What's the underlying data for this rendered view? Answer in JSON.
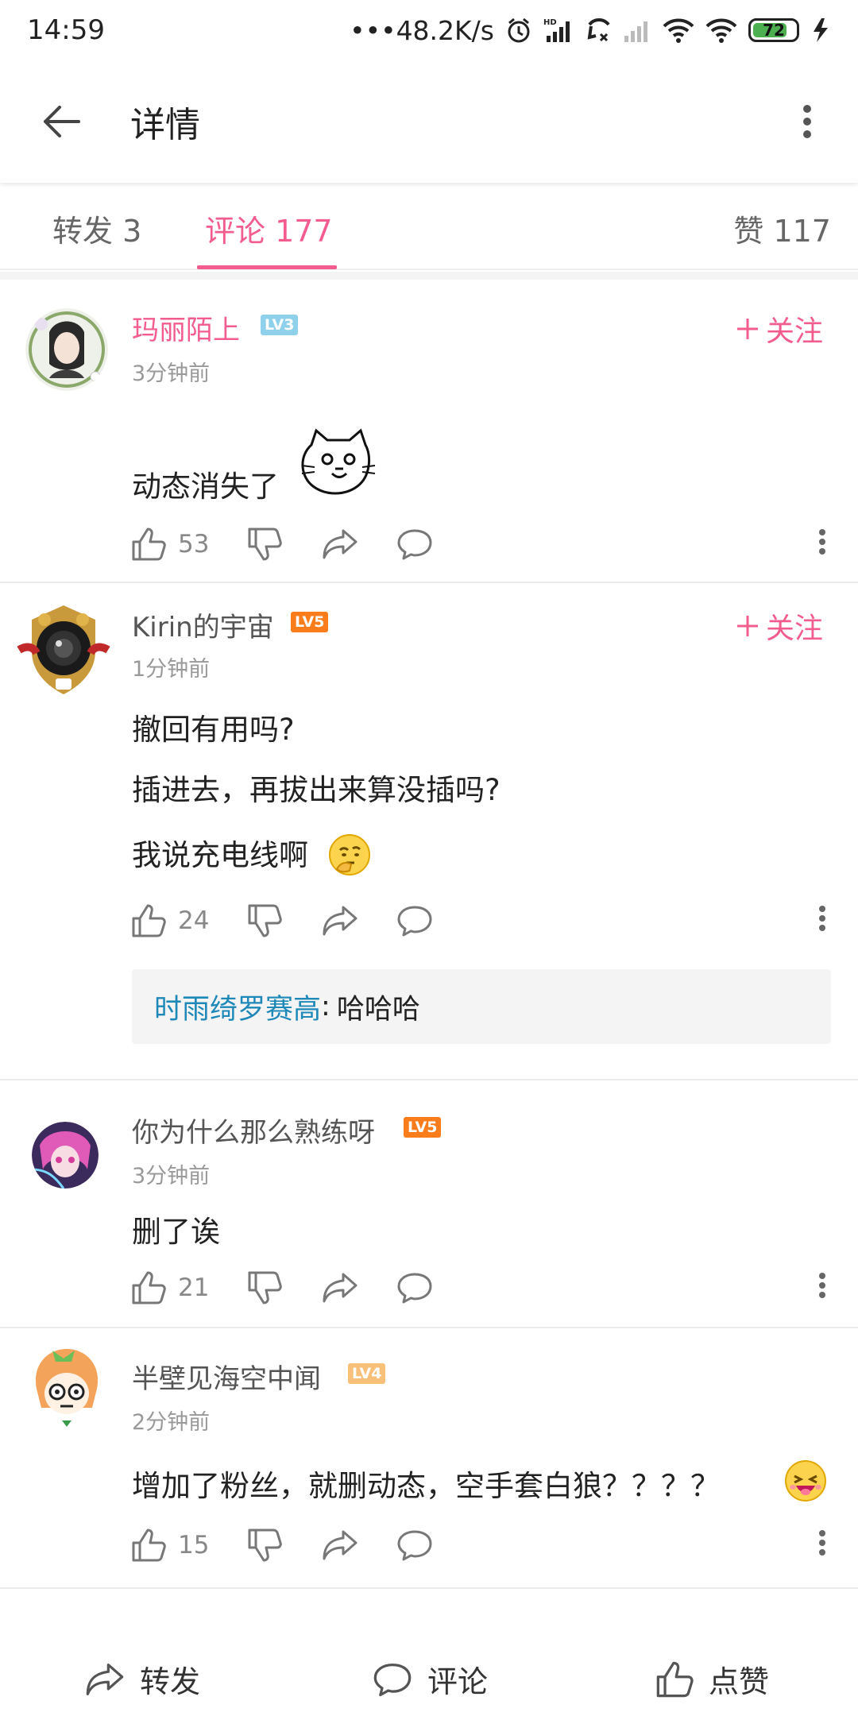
{
  "status_bar": {
    "time": "14:59",
    "net_speed": "•••48.2K/s",
    "battery": "72"
  },
  "app_bar": {
    "title": "详情"
  },
  "tabs": {
    "repost": "转发 3",
    "comment": "评论 177",
    "like": "赞 117"
  },
  "comments": [
    {
      "username": "玛丽陌上",
      "level": "LV3",
      "level_color": "#8fd0ea",
      "time": "3分钟前",
      "follow": "关注",
      "lines": [
        "动态消失了"
      ],
      "likes": "53"
    },
    {
      "username": "Kirin的宇宙",
      "level": "LV5",
      "level_color": "#fb7c1a",
      "time": "1分钟前",
      "follow": "关注",
      "lines": [
        "撤回有用吗?",
        "插进去，再拔出来算没插吗?",
        "我说充电线啊"
      ],
      "likes": "24",
      "reply": {
        "name": "时雨绮罗赛高",
        "sep": ":",
        "text": "哈哈哈"
      }
    },
    {
      "username": "你为什么那么熟练呀",
      "level": "LV5",
      "level_color": "#fb7c1a",
      "time": "3分钟前",
      "lines": [
        "删了诶"
      ],
      "likes": "21"
    },
    {
      "username": "半壁见海空中闻",
      "level": "LV4",
      "level_color": "#f9c07a",
      "time": "2分钟前",
      "lines": [
        "增加了粉丝，就删动态，空手套白狼？？？？"
      ],
      "likes": "15"
    }
  ],
  "bottom_bar": {
    "repost": "转发",
    "comment": "评论",
    "like": "点赞"
  },
  "colors": {
    "accent": "#f25d8e",
    "link": "#1e88b8"
  }
}
